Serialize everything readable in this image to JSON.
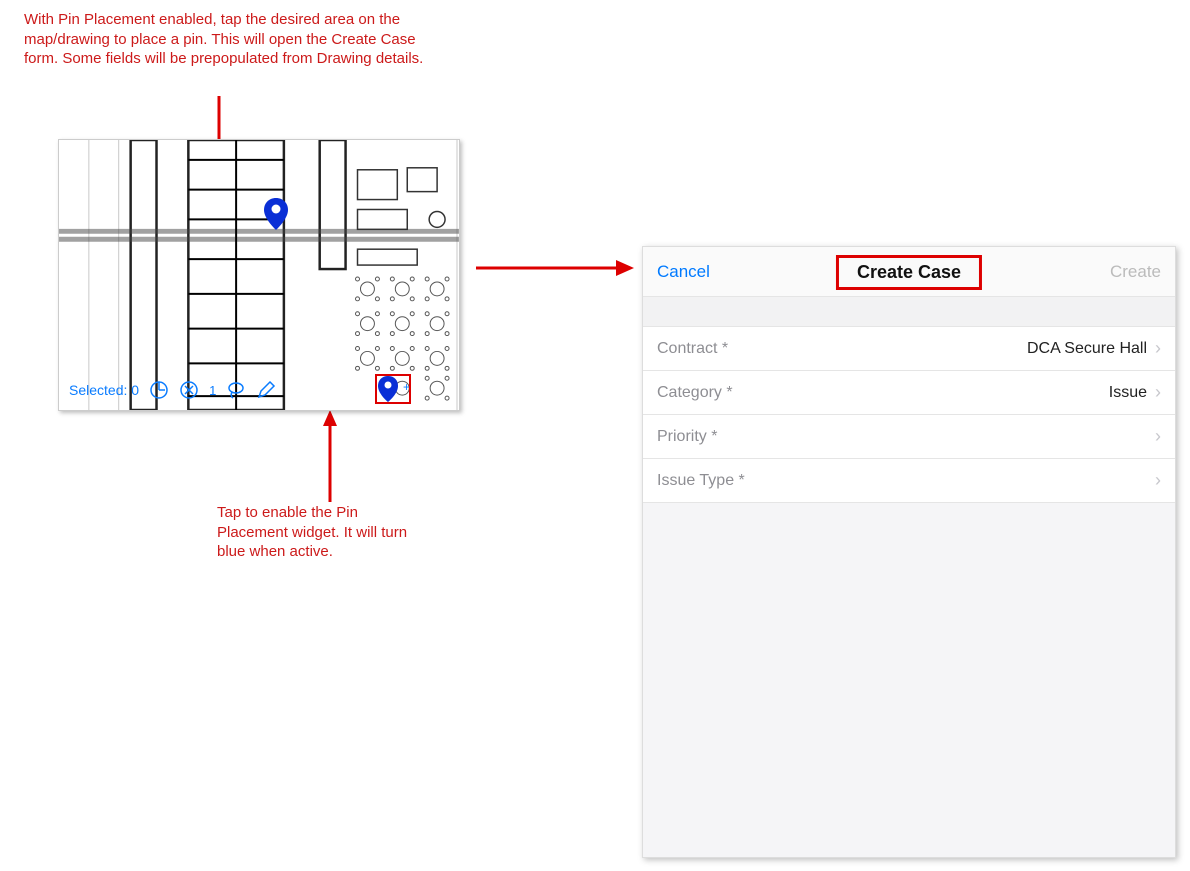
{
  "annotations": {
    "top": "With Pin Placement enabled, tap the desired area on the map/drawing to place a pin. This will open the Create Case form. Some fields will be prepopulated from Drawing details.",
    "bottom": "Tap to enable the Pin Placement widget. It will turn blue when active."
  },
  "map": {
    "selected_label": "Selected: 0",
    "toolbar_icons": [
      "arc-icon",
      "circle-x-icon",
      "lasso-icon",
      "pencil-icon",
      "pin-icon"
    ],
    "pin_plus": "+"
  },
  "form": {
    "cancel": "Cancel",
    "title": "Create Case",
    "create": "Create",
    "rows": [
      {
        "label": "Contract *",
        "value": "DCA Secure Hall"
      },
      {
        "label": "Category *",
        "value": "Issue"
      },
      {
        "label": "Priority *",
        "value": ""
      },
      {
        "label": "Issue Type *",
        "value": ""
      }
    ]
  }
}
